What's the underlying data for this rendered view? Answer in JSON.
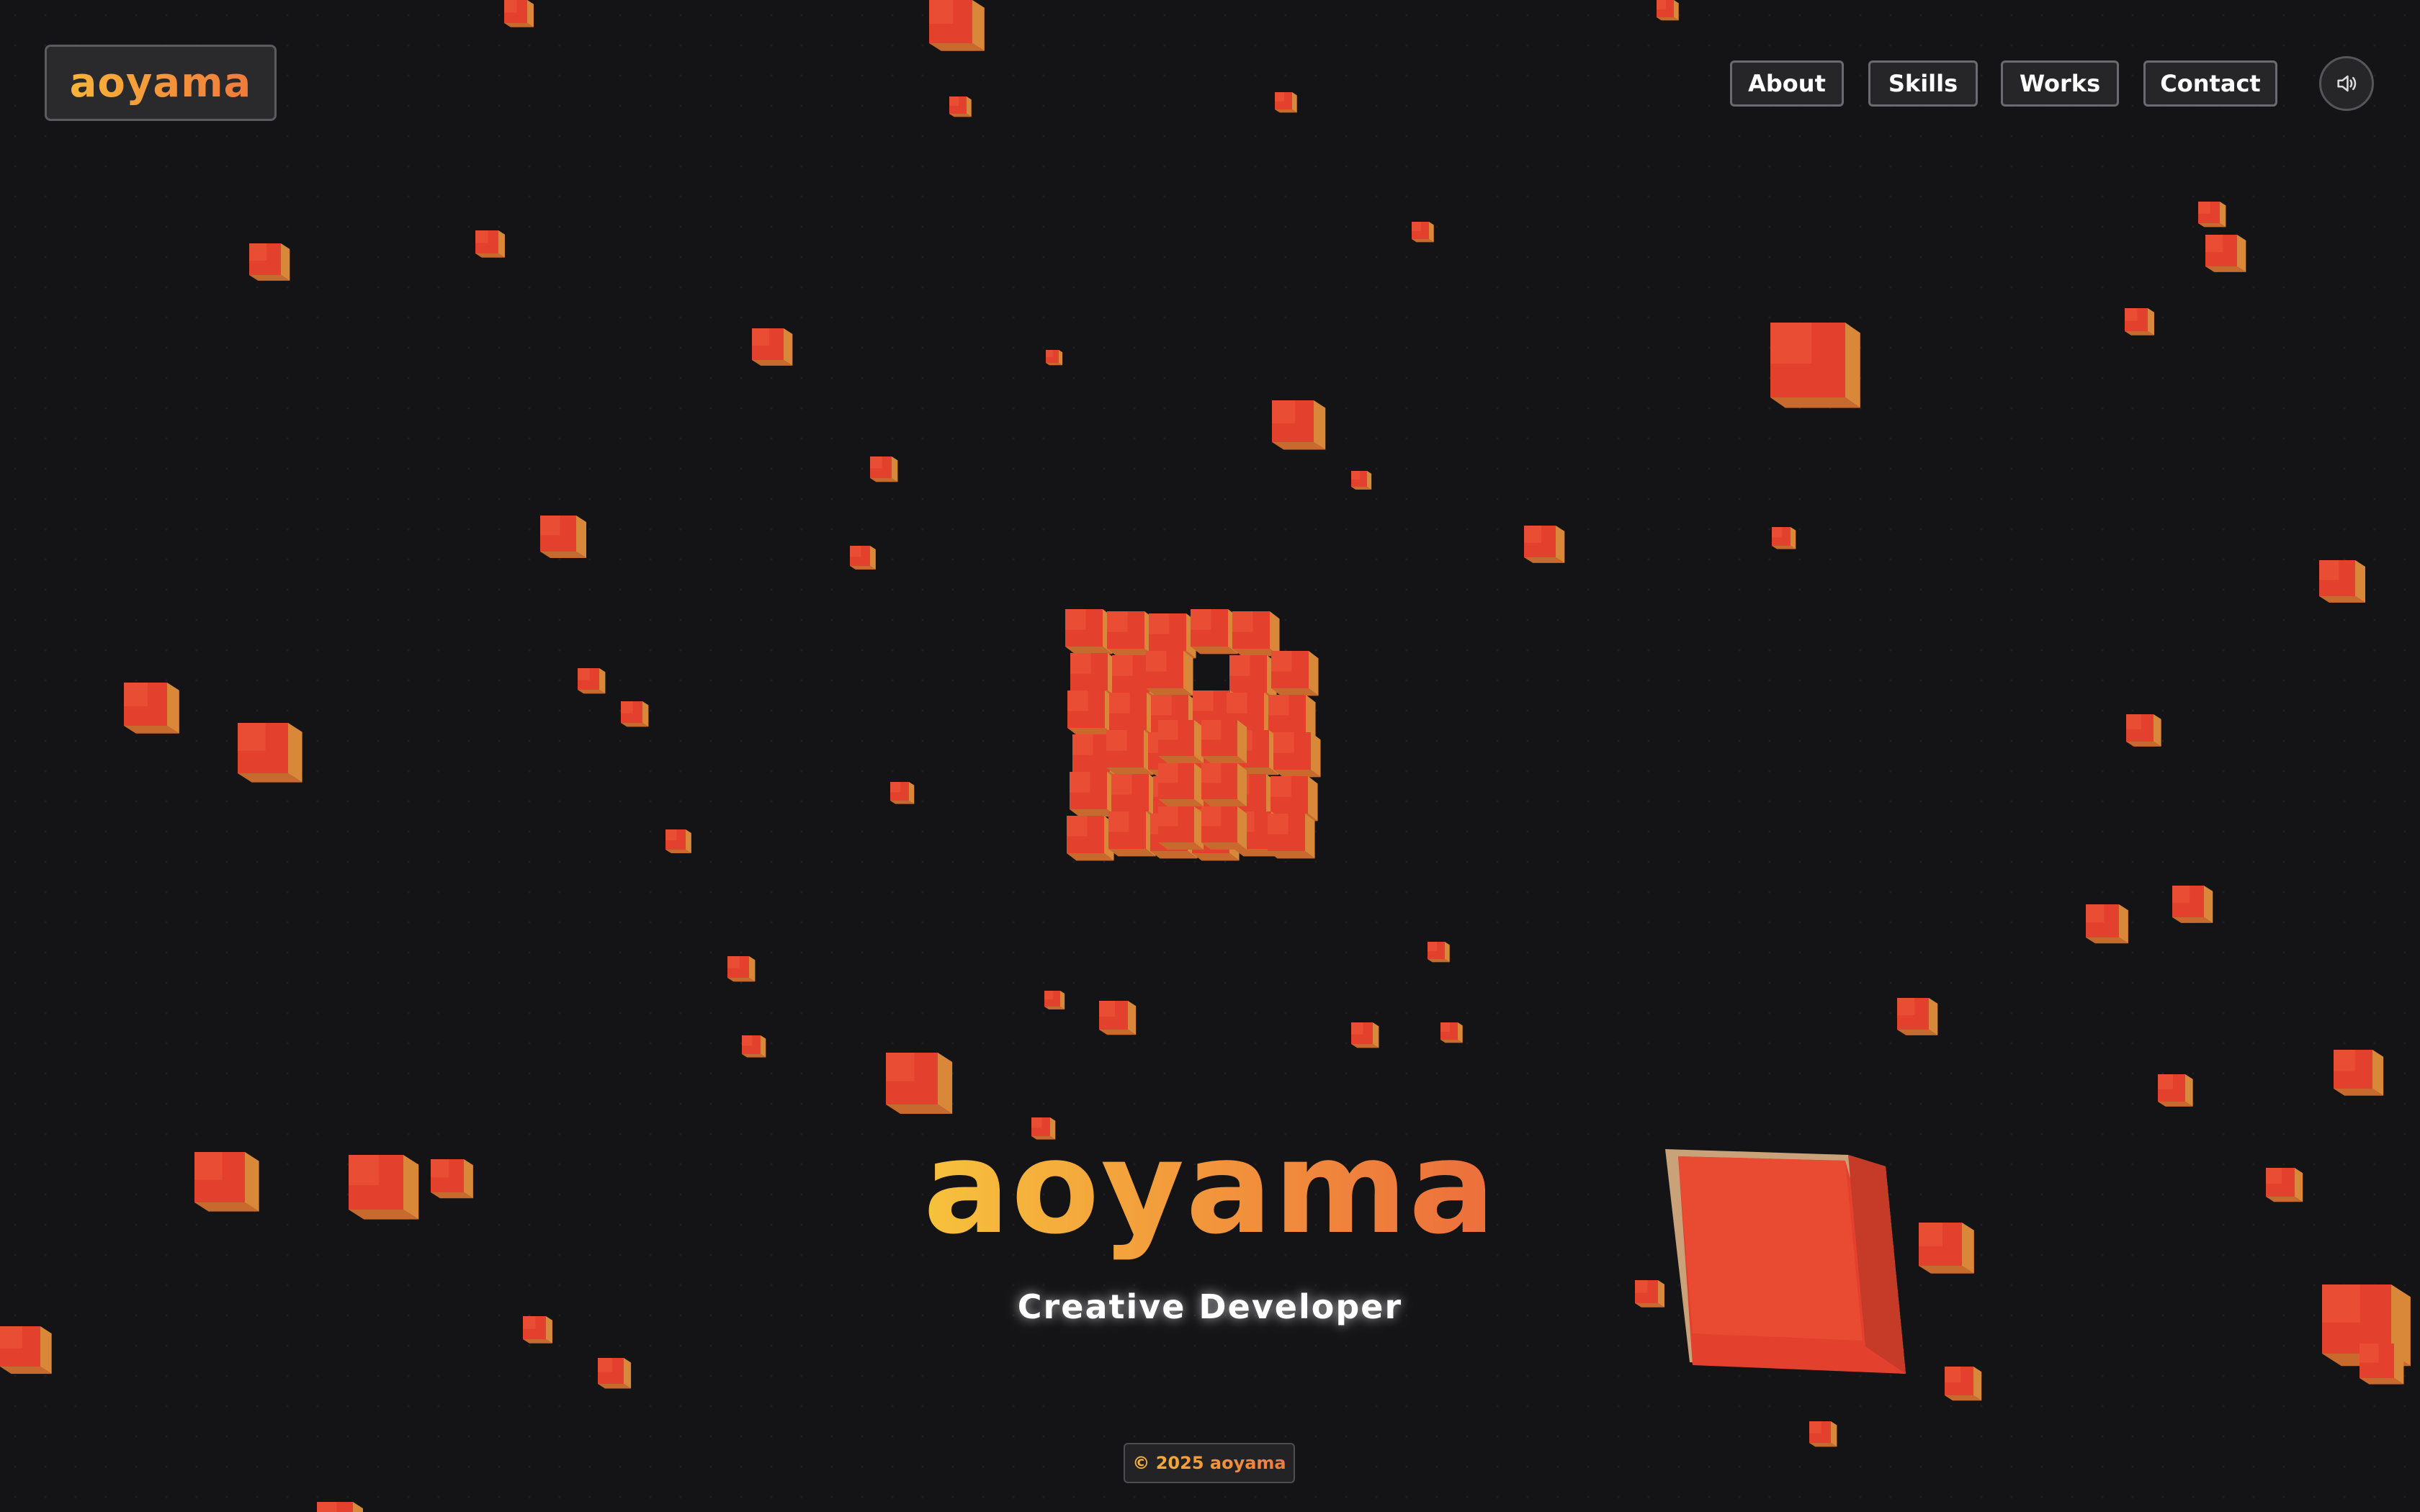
{
  "header": {
    "logo_text": "aoyama",
    "nav": [
      {
        "label": "About"
      },
      {
        "label": "Skills"
      },
      {
        "label": "Works"
      },
      {
        "label": "Contact"
      }
    ],
    "sound_icon": "speaker-icon"
  },
  "hero": {
    "title": "aoyama",
    "subtitle": "Creative Developer"
  },
  "footer": {
    "copyright": "© 2025 aoyama"
  },
  "colors": {
    "background": "#141416",
    "accent_orange": "#f2953c",
    "accent_yellow": "#f7c23c",
    "cube_red": "#e3402d"
  }
}
